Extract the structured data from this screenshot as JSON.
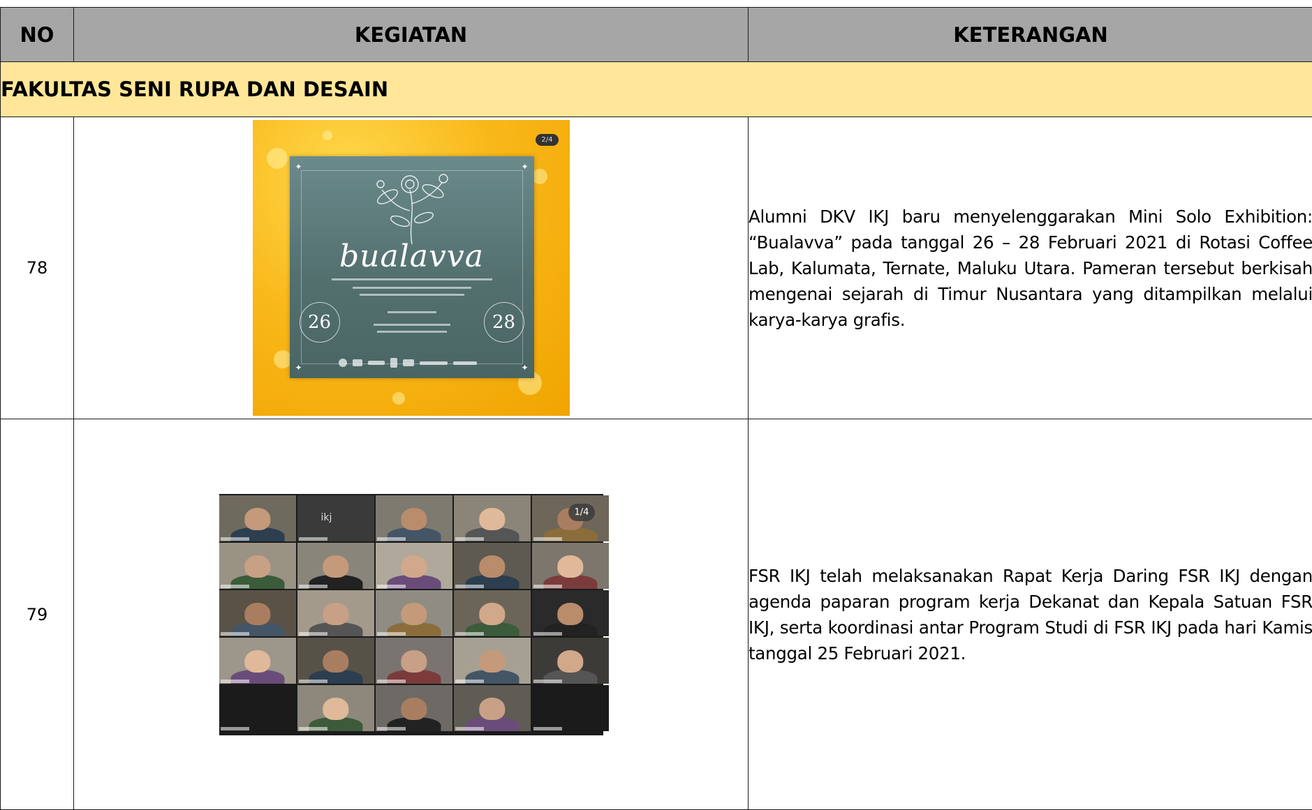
{
  "table": {
    "headers": {
      "no": "NO",
      "kegiatan": "KEGIATAN",
      "keterangan": "KETERANGAN"
    },
    "section_title": "FAKULTAS SENI RUPA DAN DESAIN",
    "rows": [
      {
        "no": "78",
        "keterangan": "Alumni DKV IKJ baru menyelenggarakan Mini Solo Exhibition: “Bualavva” pada tanggal 26 – 28 Februari 2021 di Rotasi Coffee Lab, Kalumata, Ternate, Maluku Utara. Pameran tersebut berkisah mengenai sejarah di Timur Nusantara yang ditampilkan melalui karya-karya grafis.",
        "image": {
          "kind": "poster",
          "badge": "2/4",
          "title": "bualavva",
          "day_start": "26",
          "day_end": "28",
          "colors": {
            "background": "#f9b81a",
            "panel": "#5b7877"
          }
        }
      },
      {
        "no": "79",
        "keterangan": "FSR IKJ telah melaksanakan Rapat Kerja Daring FSR IKJ dengan agenda paparan program kerja Dekanat dan Kepala Satuan FSR IKJ, serta koordinasi antar Program Studi di FSR IKJ pada hari Kamis tanggal 25 Februari 2021.",
        "image": {
          "kind": "video-call-grid",
          "pager": "1/4",
          "tile_logo": "ikj"
        }
      }
    ]
  },
  "colors": {
    "header_bg": "#a6a6a6",
    "section_bg": "#ffe699",
    "border": "#1a1a1a"
  }
}
